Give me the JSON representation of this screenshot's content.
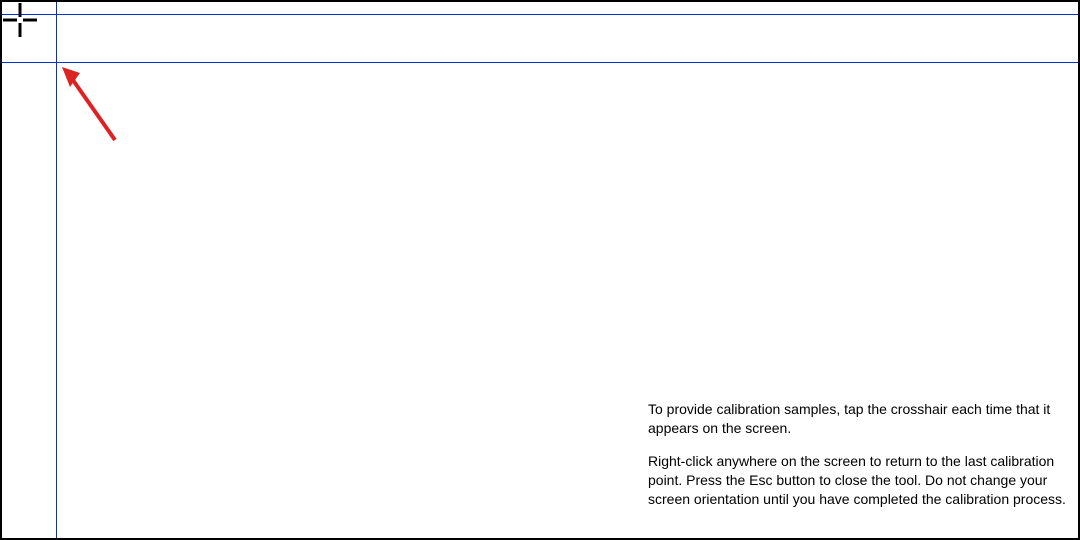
{
  "calibration": {
    "crosshair_label": "calibration crosshair",
    "instructions": {
      "paragraph1": "To provide calibration samples, tap the crosshair each time that it appears on the screen.",
      "paragraph2": "Right-click anywhere on the screen to return to the last calibration point. Press the Esc button to close the tool. Do not change your screen orientation until you have completed the calibration process."
    }
  }
}
